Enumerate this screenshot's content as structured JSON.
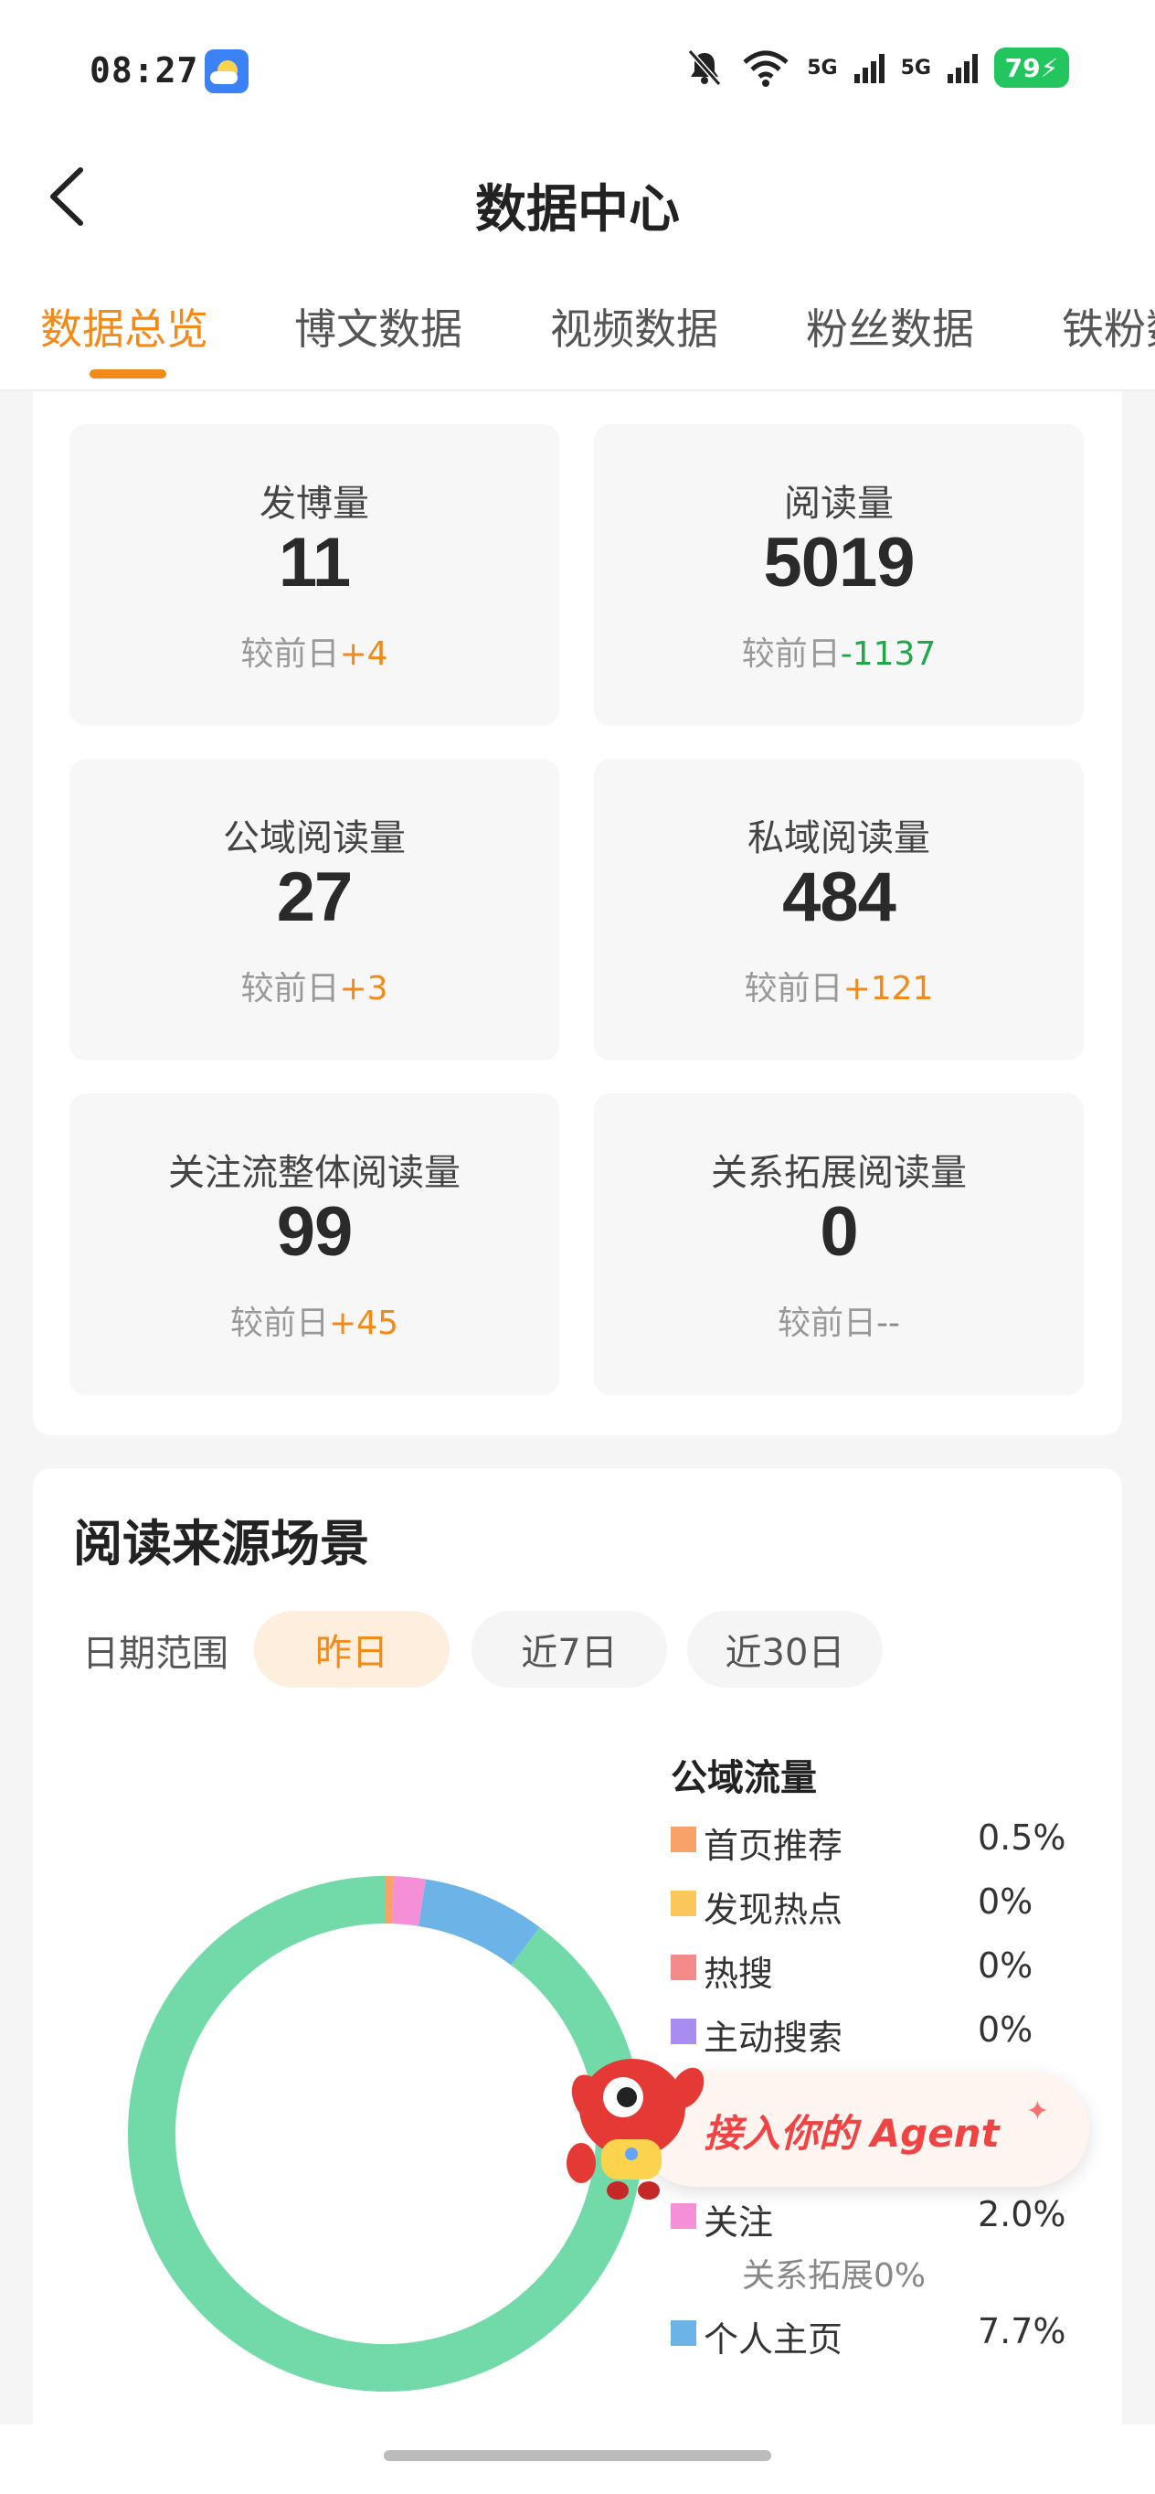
{
  "status_bar": {
    "time": "08:27",
    "network": "5G",
    "battery": "79"
  },
  "header": {
    "title": "数据中心"
  },
  "tabs": [
    {
      "label": "数据总览",
      "active": true
    },
    {
      "label": "博文数据"
    },
    {
      "label": "视频数据"
    },
    {
      "label": "粉丝数据"
    },
    {
      "label": "铁粉数据"
    }
  ],
  "metrics": [
    {
      "label": "发博量",
      "value": "11",
      "compare": "较前日",
      "delta": "+4",
      "trend": "up"
    },
    {
      "label": "阅读量",
      "value": "5019",
      "compare": "较前日",
      "delta": "-1137",
      "trend": "down"
    },
    {
      "label": "公域阅读量",
      "value": "27",
      "compare": "较前日",
      "delta": "+3",
      "trend": "up"
    },
    {
      "label": "私域阅读量",
      "value": "484",
      "compare": "较前日",
      "delta": "+121",
      "trend": "up"
    },
    {
      "label": "关注流整体阅读量",
      "value": "99",
      "compare": "较前日",
      "delta": "+45",
      "trend": "up"
    },
    {
      "label": "关系拓展阅读量",
      "value": "0",
      "compare": "较前日",
      "delta": "--",
      "trend": "none"
    }
  ],
  "reading_source": {
    "title": "阅读来源场景",
    "date_range_label": "日期范围",
    "date_options": [
      "昨日",
      "近7日",
      "近30日"
    ],
    "selected_date": "昨日",
    "legend_title": "公域流量",
    "legend": [
      {
        "label": "首页推荐",
        "pct": "0.5%",
        "color": "#f8a26a"
      },
      {
        "label": "发现热点",
        "pct": "0%",
        "color": "#fcc75a"
      },
      {
        "label": "热搜",
        "pct": "0%",
        "color": "#f58a8a"
      },
      {
        "label": "主动搜索",
        "pct": "0%",
        "color": "#a98cf0"
      },
      {
        "label": "关注",
        "pct": "2.0%",
        "color": "#f48fd8"
      },
      {
        "label": "个人主页",
        "pct": "7.7%",
        "color": "#6cb4e8"
      }
    ],
    "legend_sub": "关系拓展0%"
  },
  "chart_data": {
    "type": "pie",
    "donut": true,
    "slices": [
      {
        "value": 0.5,
        "color": "#f8a26a"
      },
      {
        "value": 2.0,
        "color": "#f48fd8"
      },
      {
        "value": 7.7,
        "color": "#6cb4e8"
      },
      {
        "value": 89.8,
        "color": "#72d9a8"
      }
    ]
  },
  "agent_banner": {
    "label": "接入你的 Agent"
  }
}
